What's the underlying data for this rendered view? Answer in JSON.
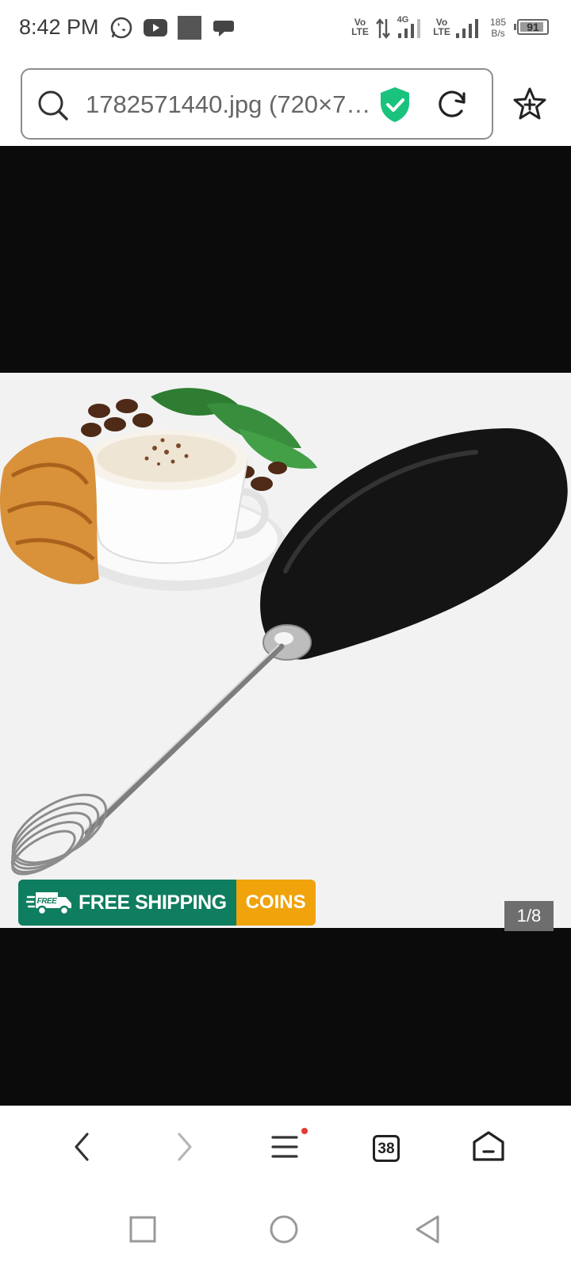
{
  "status_bar": {
    "time": "8:42 PM",
    "notification_icons": [
      "whatsapp-icon",
      "youtube-icon",
      "gallery-icon",
      "chat-icon"
    ],
    "network": {
      "volte1": "Vo\nLTE",
      "gen": "4G",
      "volte2": "Vo\nLTE",
      "speed_value": "185",
      "speed_unit": "B/s"
    },
    "battery": "91",
    "battery_level": 0.91
  },
  "address_bar": {
    "url": "1782571440.jpg (720×7…",
    "icons": [
      "search-icon",
      "secure-shield-icon",
      "reload-icon"
    ]
  },
  "bookmark_icon": "bookmark-add-icon",
  "image_viewer": {
    "badge_left": "FREE SHIPPING",
    "badge_truck_label": "FREE",
    "badge_right": "COINS",
    "page_counter": "1/8",
    "colors": {
      "shipping_green": "#0f7d5f",
      "coins_orange": "#f0a30a"
    }
  },
  "toolbar": {
    "buttons": [
      "back-icon",
      "forward-icon",
      "menu-icon",
      "tabs-icon",
      "home-icon"
    ],
    "tabs_count": "38",
    "menu_notification_color": "#e53935"
  },
  "system_nav": [
    "recents-icon",
    "home-circle-icon",
    "back-triangle-icon"
  ]
}
